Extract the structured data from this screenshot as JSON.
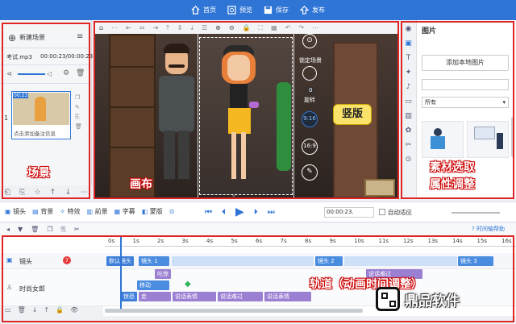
{
  "topbar": {
    "items": [
      {
        "icon": "home-icon",
        "label": "首页"
      },
      {
        "icon": "preview-icon",
        "label": "预览"
      },
      {
        "icon": "save-icon",
        "label": "保存"
      },
      {
        "icon": "publish-icon",
        "label": "发布"
      }
    ]
  },
  "left": {
    "new_scene": "新建场景",
    "audio_name": "考试.mp3",
    "audio_time": "00:00:23/00:00:23",
    "scene_number": "1",
    "scene_badge": "00:23",
    "scene_caption": "点击添加备注信息",
    "annotation": "场景"
  },
  "stage": {
    "lock_label": "锁定场景",
    "rotate_value": "0",
    "rotate_label": "旋转",
    "ratio_916": "9:16",
    "ratio_169": "16:9",
    "vertical_callout": "竖版",
    "annotation": "画布"
  },
  "right": {
    "title": "图片",
    "add_local": "添加本地图片",
    "filter_value": "所有",
    "annotation_line1": "素材选取",
    "annotation_line2": "属性调整"
  },
  "controls": {
    "items": [
      "镜头",
      "背景",
      "特效",
      "前景",
      "字幕",
      "蒙版"
    ],
    "time_value": "00:00:23.",
    "auto_fit": "自动适应"
  },
  "timeline": {
    "help": "时间轴帮助",
    "ticks": [
      "0s",
      "1s",
      "2s",
      "3s",
      "4s",
      "5s",
      "6s",
      "7s",
      "8s",
      "9s",
      "10s",
      "11s",
      "12s",
      "13s",
      "14s",
      "15s",
      "16s"
    ],
    "track_camera": "镜头",
    "track_camera_badge": "7",
    "track_role": "时尚女郎",
    "clip_default": "默认镜头",
    "clip_cam1": "镜头 1",
    "clip_cam2": "镜头 2",
    "clip_cam3": "镜头 3",
    "clip_think": "吃惊",
    "clip_move": "移动",
    "clip_walk": "走",
    "clip_say1": "说话表情",
    "clip_say2": "说话难过",
    "clip_say3": "说话表情",
    "clip_top": "说话难过",
    "clip_row4a": "惊恐",
    "annotation": "轨道（动画时间调整）"
  },
  "brand": {
    "name": "鼎品软件"
  }
}
